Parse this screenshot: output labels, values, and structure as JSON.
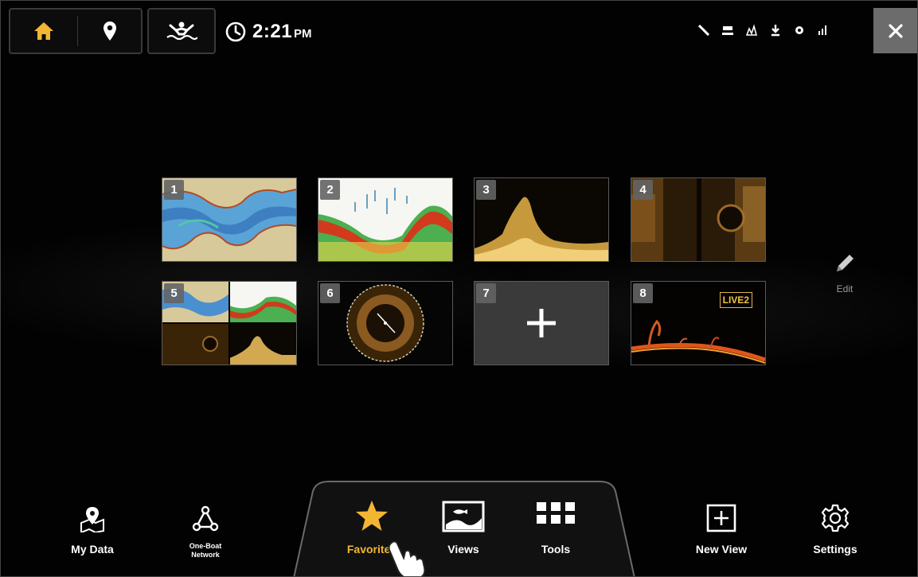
{
  "topbar": {
    "home_icon": "home-icon",
    "waypoint_icon": "waypoint-pin-icon",
    "man_overboard_icon": "man-overboard-icon",
    "clock_icon": "clock-icon",
    "time": "2:21",
    "ampm": "PM",
    "status_icons": [
      "antenna-icon",
      "sonar-icon",
      "chart-icon",
      "down-imaging-icon",
      "gps-icon",
      "signal-icon"
    ],
    "close_icon": "close-icon"
  },
  "tiles": [
    {
      "number": "1",
      "content": "chart-map-view"
    },
    {
      "number": "2",
      "content": "2d-sonar-view"
    },
    {
      "number": "3",
      "content": "down-imaging-view"
    },
    {
      "number": "4",
      "content": "side-imaging-view"
    },
    {
      "number": "5",
      "content": "quad-combo-view"
    },
    {
      "number": "6",
      "content": "360-imaging-view"
    },
    {
      "number": "7",
      "content": "add-new-favorite"
    },
    {
      "number": "8",
      "content": "live-sonar-view",
      "badge": "LIVE2"
    }
  ],
  "edit": {
    "label": "Edit",
    "icon": "pencil-icon"
  },
  "bottom_nav": {
    "my_data": "My Data",
    "one_boat_line1": "One-Boat",
    "one_boat_line2": "Network",
    "favorites": "Favorites",
    "views": "Views",
    "tools": "Tools",
    "new_view": "New View",
    "settings": "Settings"
  },
  "colors": {
    "accent": "#f2b632",
    "background": "#000000",
    "close_button": "#6c6c6c",
    "tile_add": "#3a3a3a"
  }
}
